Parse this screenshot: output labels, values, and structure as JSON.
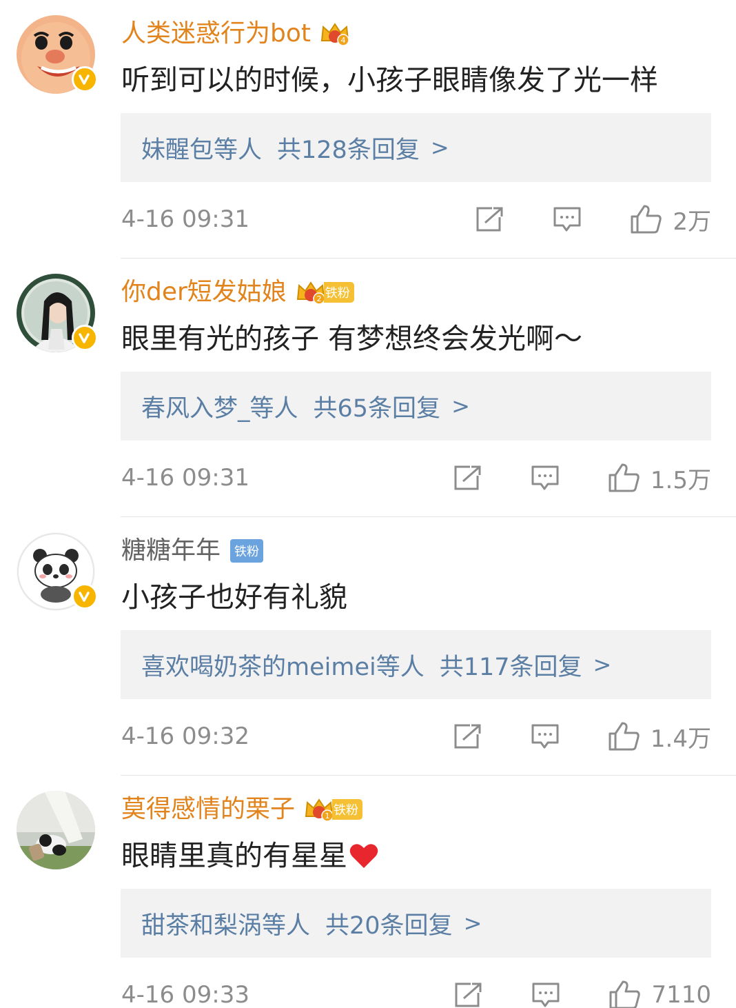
{
  "comments": [
    {
      "username": "人类迷惑行为bot",
      "level": "4",
      "fan_tag": "",
      "text": "听到可以的时候，小孩子眼睛像发了光一样",
      "reply_names": "妹醒包等人",
      "reply_count": "共128条回复",
      "reply_arrow": ">",
      "timestamp": "4-16 09:31",
      "likes": "2万"
    },
    {
      "username": "你der短发姑娘",
      "level": "2",
      "fan_tag": "铁粉",
      "text": "眼里有光的孩子 有梦想终会发光啊～",
      "reply_names": "春风入梦_等人",
      "reply_count": "共65条回复",
      "reply_arrow": ">",
      "timestamp": "4-16 09:31",
      "likes": "1.5万"
    },
    {
      "username": "糖糖年年",
      "level": "",
      "fan_tag": "铁粉",
      "text": "小孩子也好有礼貌",
      "reply_names": "喜欢喝奶茶的meimei等人",
      "reply_count": "共117条回复",
      "reply_arrow": ">",
      "timestamp": "4-16 09:32",
      "likes": "1.4万"
    },
    {
      "username": "莫得感情的栗子",
      "level": "1",
      "fan_tag": "铁粉",
      "text": "眼睛里真的有星星",
      "reply_names": "甜茶和梨涡等人",
      "reply_count": "共20条回复",
      "reply_arrow": ">",
      "timestamp": "4-16 09:33",
      "likes": "7110"
    }
  ],
  "colors": {
    "username_vip": "#e2841d",
    "username_plain": "#636363",
    "reply_link": "#5b7ea4",
    "meta_text": "#8c8c8c",
    "verified_badge": "#f7b500",
    "reply_box_bg": "#f2f2f2"
  },
  "icons": {
    "share": "share-icon",
    "comment": "comment-icon",
    "like": "thumbs-up-icon",
    "verified": "verified-v-icon",
    "crown": "crown-badge-icon",
    "heart": "heart-icon"
  }
}
